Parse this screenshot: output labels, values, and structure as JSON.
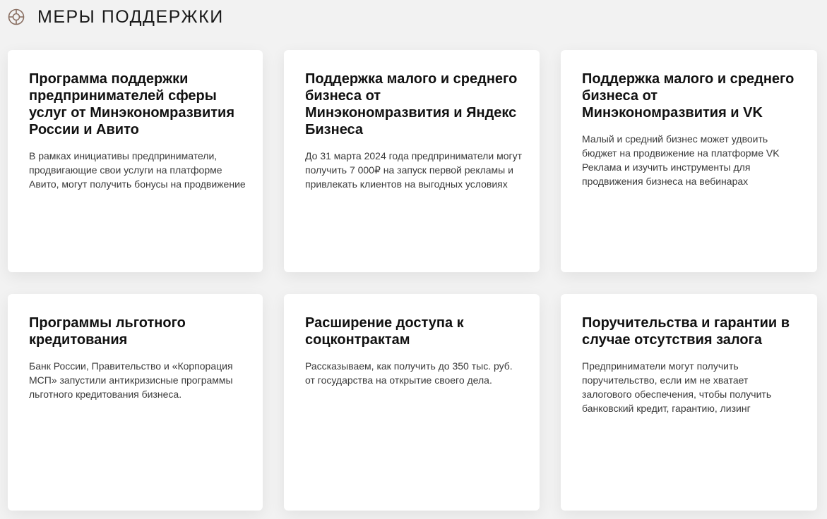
{
  "header": {
    "icon": "lifebuoy-icon",
    "title": "МЕРЫ ПОДДЕРЖКИ",
    "icon_color": "#8a6f62"
  },
  "cards": [
    {
      "title": "Программа поддержки предпринимателей сферы услуг от Минэкономразвития России и Авито",
      "text": "В рамках инициативы предприниматели, продвигающие свои услуги на платформе Авито, могут получить бонусы на продвижение"
    },
    {
      "title": "Поддержка малого и среднего бизнеса от Минэкономразвития и Яндекс Бизнеса",
      "text": "До 31 марта 2024 года предприниматели могут получить 7 000₽ на запуск первой рекламы и привлекать клиентов на выгодных условиях"
    },
    {
      "title": "Поддержка малого и среднего бизнеса от Минэкономразвития и VK",
      "text": "Малый и средний бизнес может удвоить бюджет на продвижение на платформе VK Реклама и изучить инструменты для продвижения бизнеса на вебинарах"
    },
    {
      "title": "Программы льготного кредитования",
      "text": "Банк России, Правительство и «Корпорация МСП» запустили антикризисные программы льготного кредитования бизнеса."
    },
    {
      "title": "Расширение доступа к соцконтрактам",
      "text": "Рассказываем, как получить до 350 тыс. руб. от государства на открытие своего дела."
    },
    {
      "title": "Поручительства и гарантии в случае отсутствия залога",
      "text": "Предприниматели могут получить поручительство, если им не хватает залогового обеспечения, чтобы получить банковский кредит, гарантию, лизинг"
    }
  ]
}
